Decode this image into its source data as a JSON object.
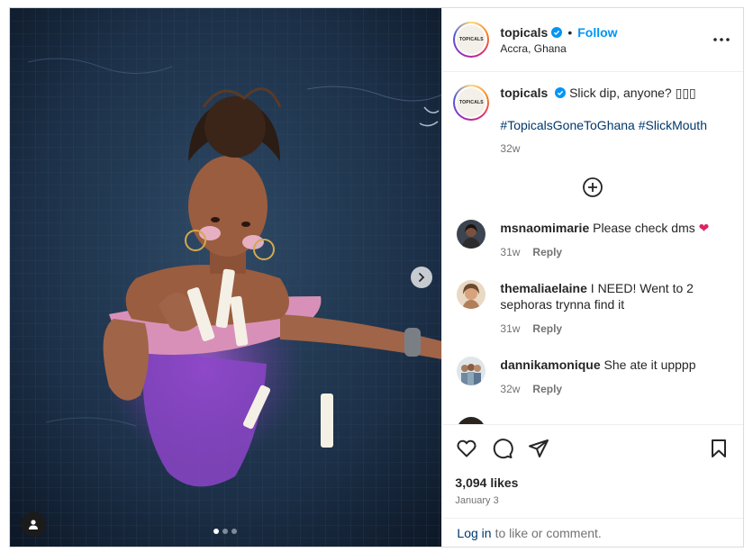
{
  "account": {
    "username": "topicals",
    "avatar_text": "TOPICALS",
    "verified": true,
    "follow_label": "Follow",
    "location": "Accra, Ghana"
  },
  "caption": {
    "username": "topicals",
    "text": "Slick dip, anyone? ▯▯▯",
    "hashtags": "#TopicalsGoneToGhana #SlickMouth",
    "time": "32w"
  },
  "comments": [
    {
      "username": "msnaomimarie",
      "text": "Please check dms",
      "emoji": "❤",
      "time": "31w",
      "reply_label": "Reply"
    },
    {
      "username": "themaliaelaine",
      "text": "I NEED! Went to 2 sephoras trynna find it",
      "emoji": "",
      "time": "31w",
      "reply_label": "Reply"
    },
    {
      "username": "dannikamonique",
      "text": "She ate it upppp",
      "emoji": "",
      "time": "32w",
      "reply_label": "Reply"
    }
  ],
  "engagement": {
    "likes": "3,094 likes",
    "date": "January 3"
  },
  "login_bar": {
    "link": "Log in",
    "text": "to like or comment."
  },
  "carousel": {
    "total_slides": 3,
    "current_slide": 1
  },
  "icons": [
    "verified-badge-icon",
    "more-options-icon",
    "load-more-comments-icon",
    "heart-icon",
    "comment-icon",
    "share-icon",
    "save-icon",
    "next-slide-icon",
    "user-tag-icon"
  ],
  "colors": {
    "link_blue": "#0095f6",
    "hashtag": "#00376b",
    "muted": "#737373",
    "border": "#dbdbdb"
  }
}
